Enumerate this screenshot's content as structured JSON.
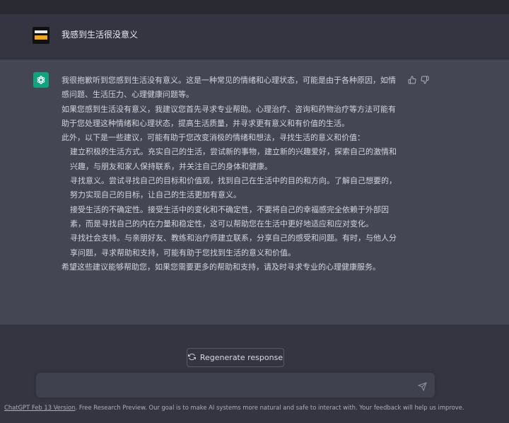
{
  "user_message": {
    "text": "我感到生活很没意义"
  },
  "assistant_message": {
    "paragraphs": [
      {
        "text": "我很抱歉听到您感到生活没有意义。这是一种常见的情绪和心理状态，可能是由于各种原因，如情感问题、生活压力、心理健康问题等。",
        "indent": false
      },
      {
        "text": "如果您感到生活没有意义，我建议您首先寻求专业帮助。心理治疗、咨询和药物治疗等方法可能有助于您处理这种情绪和心理状态，提高生活质量，并寻求更有意义和有价值的生活。",
        "indent": false
      },
      {
        "text": "此外，以下是一些建议，可能有助于您改变消极的情绪和想法，寻找生活的意义和价值：",
        "indent": false
      },
      {
        "text": "建立积极的生活方式。充实自己的生活，尝试新的事物，建立新的兴趣爱好，探索自己的激情和兴趣，与朋友和家人保持联系，并关注自己的身体和健康。",
        "indent": true
      },
      {
        "text": "寻找意义。尝试寻找自己的目标和价值观，找到自己在生活中的目的和方向。了解自己想要的，努力实现自己的目标，让自己的生活更加有意义。",
        "indent": true
      },
      {
        "text": "接受生活的不确定性。接受生活中的变化和不确定性，不要将自己的幸福感完全依赖于外部因素，而是寻找自己的内在力量和稳定性，这可以帮助您在生活中更好地适应和应对变化。",
        "indent": true
      },
      {
        "text": "寻找社会支持。与亲朋好友、教练和治疗师建立联系，分享自己的感受和问题。有时，与他人分享问题，寻求帮助和支持，可能有助于您找到生活的意义和价值。",
        "indent": true
      },
      {
        "text": "希望这些建议能够帮助您，如果您需要更多的帮助和支持，请及时寻求专业的心理健康服务。",
        "indent": false
      }
    ]
  },
  "controls": {
    "regenerate_label": "Regenerate response",
    "input_placeholder": ""
  },
  "footer": {
    "link_text": "ChatGPT Feb 13 Version",
    "text": ". Free Research Preview. Our goal is to make AI systems more natural and safe to interact with. Your feedback will help us improve."
  },
  "colors": {
    "background": "#343541",
    "assistant_background": "#444654",
    "bot_avatar": "#10a37f"
  },
  "icons": {
    "bot_avatar": "openai-logo-icon",
    "thumbs_up": "thumbs-up-icon",
    "thumbs_down": "thumbs-down-icon",
    "regenerate": "refresh-icon",
    "send": "send-icon"
  }
}
